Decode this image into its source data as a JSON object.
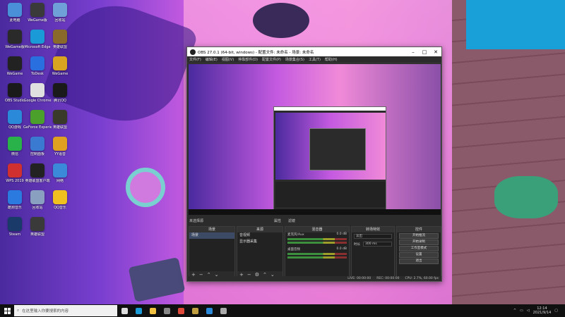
{
  "desktop": {
    "icons": [
      {
        "label": "此电脑",
        "icon": "computer-icon",
        "color": "#4a90d9"
      },
      {
        "label": "WeGame版",
        "icon": "wegame-icon",
        "color": "#3a3a3a"
      },
      {
        "label": "回收站",
        "icon": "recycle-bin-icon",
        "color": "#6fa0d8"
      },
      {
        "label": "WeGame版",
        "icon": "wegame-icon",
        "color": "#2a2a2a"
      },
      {
        "label": "Microsoft Edge",
        "icon": "edge-icon",
        "color": "#1a9ad6"
      },
      {
        "label": "英雄联盟",
        "icon": "lol-icon",
        "color": "#8a6a2a"
      },
      {
        "label": "WeGame",
        "icon": "wegame-icon",
        "color": "#222222"
      },
      {
        "label": "ToDesk",
        "icon": "todesk-icon",
        "color": "#2a6fe0"
      },
      {
        "label": "WeGame",
        "icon": "wegame-icon",
        "color": "#d9a520"
      },
      {
        "label": "OBS Studio",
        "icon": "obs-icon",
        "color": "#1a1a1a"
      },
      {
        "label": "Google Chrome",
        "icon": "chrome-icon",
        "color": "#e0e0e0"
      },
      {
        "label": "腾讯QQ",
        "icon": "qq-icon",
        "color": "#1a1a1a"
      },
      {
        "label": "QQ游戏",
        "icon": "qq-game-icon",
        "color": "#2a8ad9"
      },
      {
        "label": "GeForce Experience",
        "icon": "nvidia-icon",
        "color": "#4aa02a"
      },
      {
        "label": "英雄联盟",
        "icon": "lol-icon",
        "color": "#3a3a2a"
      },
      {
        "label": "微信",
        "icon": "wechat-icon",
        "color": "#2ab24a"
      },
      {
        "label": "控制面板",
        "icon": "control-panel-icon",
        "color": "#3a7ad0"
      },
      {
        "label": "YY语音",
        "icon": "yy-icon",
        "color": "#e0a020"
      },
      {
        "label": "WPS 2019",
        "icon": "wps-icon",
        "color": "#d03030"
      },
      {
        "label": "英雄联盟客户端",
        "icon": "lol-icon",
        "color": "#222222"
      },
      {
        "label": "网络",
        "icon": "network-icon",
        "color": "#3a8ad9"
      },
      {
        "label": "酷狗音乐",
        "icon": "kugou-icon",
        "color": "#2a7ae0"
      },
      {
        "label": "回收站",
        "icon": "recycle-bin-icon",
        "color": "#8aa0c0"
      },
      {
        "label": "QQ音乐",
        "icon": "qq-music-icon",
        "color": "#f0c020"
      },
      {
        "label": "Steam",
        "icon": "steam-icon",
        "color": "#1a3a6a"
      },
      {
        "label": "英雄联盟",
        "icon": "lol-icon",
        "color": "#3a3a3a"
      }
    ]
  },
  "obs": {
    "title": "OBS 27.0.1 (64-bit, windows) - 配置文件: 未命名 - 场景: 未命名",
    "menu": [
      "文件(F)",
      "编辑(E)",
      "视图(V)",
      "停靠部件(D)",
      "配置文件(P)",
      "场景集合(S)",
      "工具(T)",
      "帮助(H)"
    ],
    "scene_bar_label": "未选择源",
    "scene_bar_props": "属性",
    "scene_bar_filters": "滤镜",
    "panels": {
      "scenes": {
        "title": "场景",
        "items": [
          "场景"
        ]
      },
      "sources": {
        "title": "来源",
        "items": [
          "音视频",
          "显示器采集"
        ]
      },
      "mixer": {
        "title": "混音器",
        "channels": [
          {
            "name": "麦克风/Aux",
            "db": "0.0 dB"
          },
          {
            "name": "桌面音频",
            "db": "0.0 dB"
          }
        ]
      },
      "transitions": {
        "title": "转场特效",
        "type": "淡出",
        "duration_label": "时长",
        "duration": "300 ms"
      },
      "controls": {
        "title": "控件",
        "buttons": [
          "开始推流",
          "开始录制",
          "工作室模式",
          "设置",
          "退出"
        ]
      }
    },
    "status": {
      "live": "LIVE: 00:00:00",
      "rec": "REC: 00:00:00",
      "cpu": "CPU: 2.7%, 60.00 fps"
    }
  },
  "taskbar": {
    "search_placeholder": "在这里输入你要搜索的内容",
    "apps": [
      {
        "icon": "task-view-icon",
        "color": "#dddddd"
      },
      {
        "icon": "edge-icon",
        "color": "#1a9ad6"
      },
      {
        "icon": "file-explorer-icon",
        "color": "#f0c040"
      },
      {
        "icon": "wegame-icon",
        "color": "#888888"
      },
      {
        "icon": "chrome-icon",
        "color": "#e04a3a"
      },
      {
        "icon": "lol-icon",
        "color": "#c0a040"
      },
      {
        "icon": "qq-icon",
        "color": "#2a8ad9"
      },
      {
        "icon": "obs-icon",
        "color": "#aaaaaa"
      }
    ],
    "time": "12:14",
    "date": "2021/9/14"
  }
}
